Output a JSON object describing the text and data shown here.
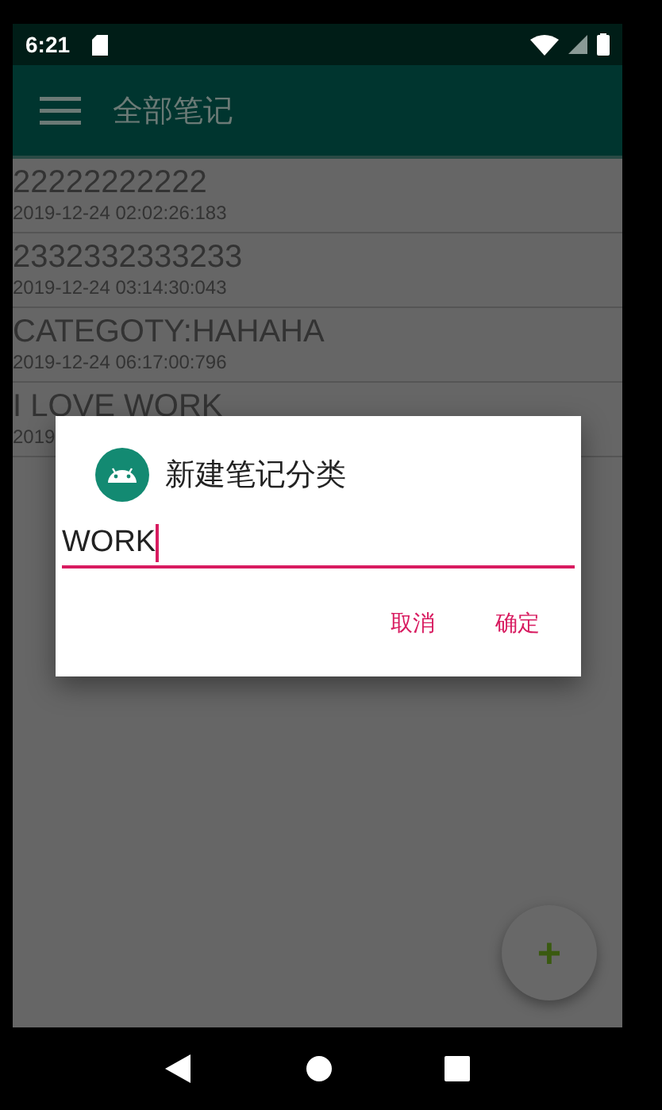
{
  "status_bar": {
    "time": "6:21"
  },
  "app_bar": {
    "title": "全部笔记"
  },
  "notes": [
    {
      "title": "22222222222",
      "date": "2019-12-24 02:02:26:183"
    },
    {
      "title": "2332332333233",
      "date": "2019-12-24 03:14:30:043"
    },
    {
      "title": "CATEGOTY:HAHAHA",
      "date": "2019-12-24 06:17:00:796"
    },
    {
      "title": "I LOVE WORK",
      "date": "2019"
    }
  ],
  "dialog": {
    "title": "新建笔记分类",
    "value": "WORK",
    "buttons": [
      "取消",
      "确定"
    ]
  },
  "fab": {
    "label": "+"
  }
}
